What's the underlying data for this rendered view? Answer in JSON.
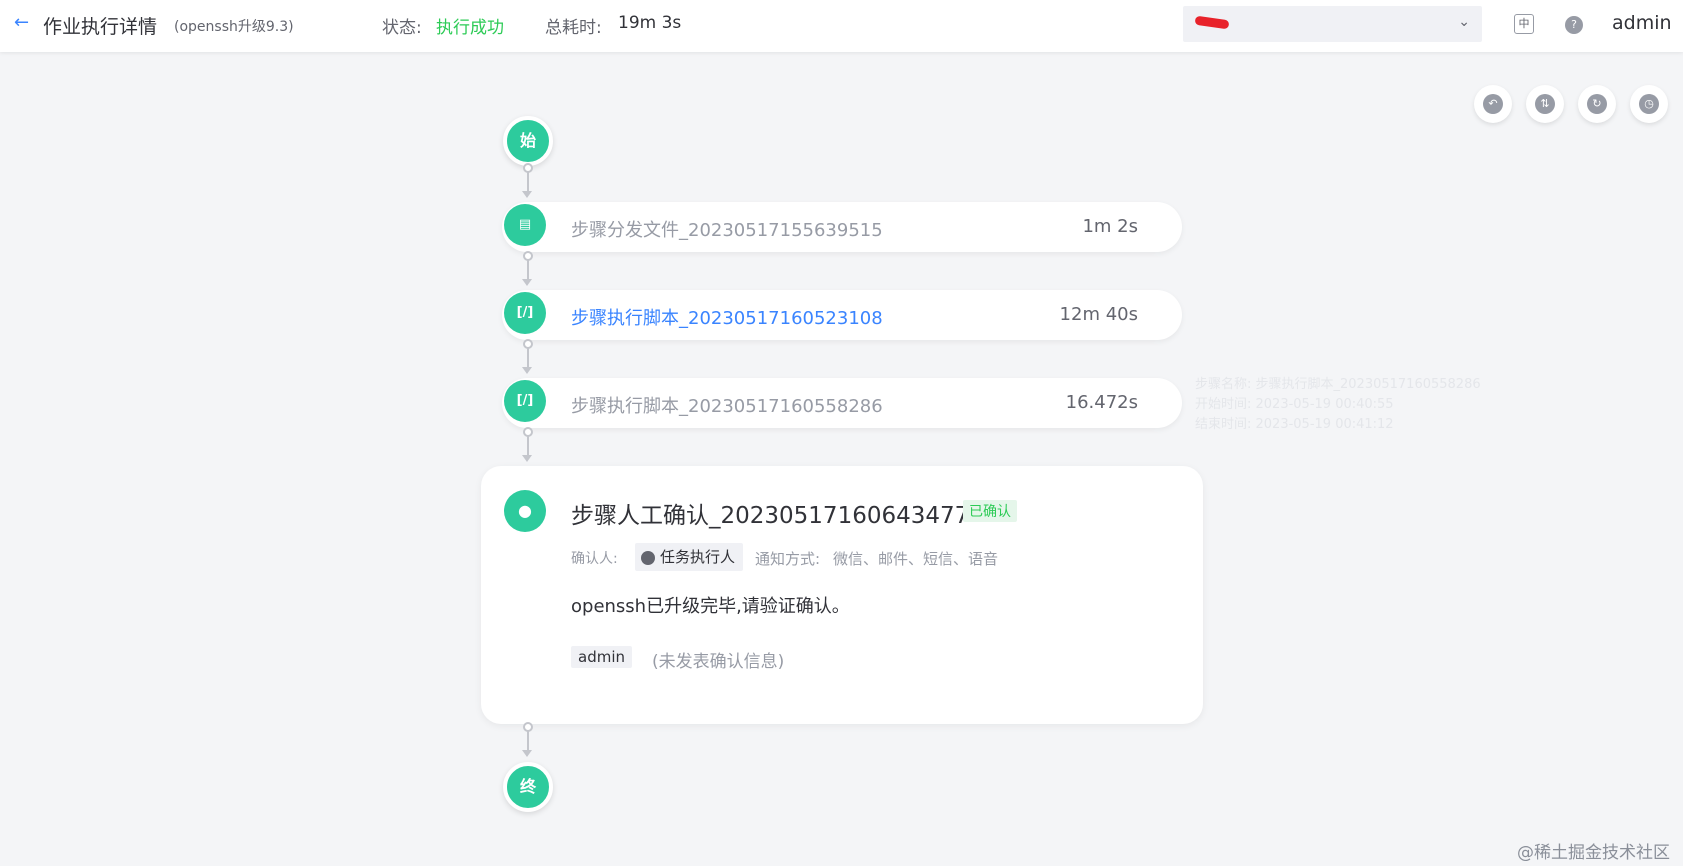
{
  "header": {
    "title": "作业执行详情",
    "subtitle": "(openssh升级9.3)",
    "status_label": "状态:",
    "status_value": "执行成功",
    "duration_label": "总耗时:",
    "duration_value": "19m 3s",
    "lang_icon": "中",
    "user": "admin"
  },
  "flow": {
    "start_label": "始",
    "end_label": "终",
    "steps": [
      {
        "name": "步骤分发文件_20230517155639515",
        "time": "1m 2s",
        "icon": "file-icon"
      },
      {
        "name": "步骤执行脚本_20230517160523108",
        "time": "12m 40s",
        "icon": "script-icon"
      },
      {
        "name": "步骤执行脚本_20230517160558286",
        "time": "16.472s",
        "icon": "script-icon"
      }
    ],
    "tooltip": {
      "line1": "步骤名称: 步骤执行脚本_20230517160558286",
      "line2": "开始时间: 2023-05-19 00:40:55",
      "line3": "结束时间: 2023-05-19 00:41:12"
    },
    "confirm": {
      "title": "步骤人工确认_20230517160643477",
      "badge": "已确认",
      "confirmer_label": "确认人:",
      "confirmer": "任务执行人",
      "notify_label": "通知方式:",
      "notify_value": "微信、邮件、短信、语音",
      "description": "openssh已升级完毕,请验证确认。",
      "user": "admin",
      "no_message": "(未发表确认信息)"
    }
  },
  "watermark": "@稀土掘金技术社区"
}
